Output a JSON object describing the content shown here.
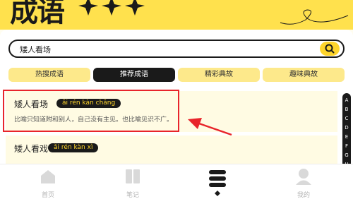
{
  "header": {
    "logo_text": "成语"
  },
  "search": {
    "value": "矮人看场"
  },
  "tabs": [
    {
      "label": "热搜成语",
      "active": false
    },
    {
      "label": "推荐成语",
      "active": true
    },
    {
      "label": "精彩典故",
      "active": false
    },
    {
      "label": "趣味典故",
      "active": false
    }
  ],
  "entries": [
    {
      "title": "矮人看场",
      "pinyin": "ǎi rén kàn chǎng",
      "definition": "比喻只知道附和别人，自己没有主见。也比喻见识不广。"
    },
    {
      "title": "矮人看戏",
      "pinyin": "ǎi rén kàn xì"
    }
  ],
  "alphabet": [
    "A",
    "B",
    "C",
    "D",
    "E",
    "F",
    "G",
    "H"
  ],
  "nav": [
    {
      "label": "首页",
      "icon": "home-icon"
    },
    {
      "label": "笔记",
      "icon": "book-icon"
    },
    {
      "label": "",
      "icon": "stack-icon",
      "active": true
    },
    {
      "label": "我的",
      "icon": "profile-icon"
    }
  ],
  "colors": {
    "brand_yellow": "#ffe14d",
    "dark": "#1a1a1a",
    "highlight_red": "#e8242b",
    "pinyin_text": "#ffd52b"
  }
}
